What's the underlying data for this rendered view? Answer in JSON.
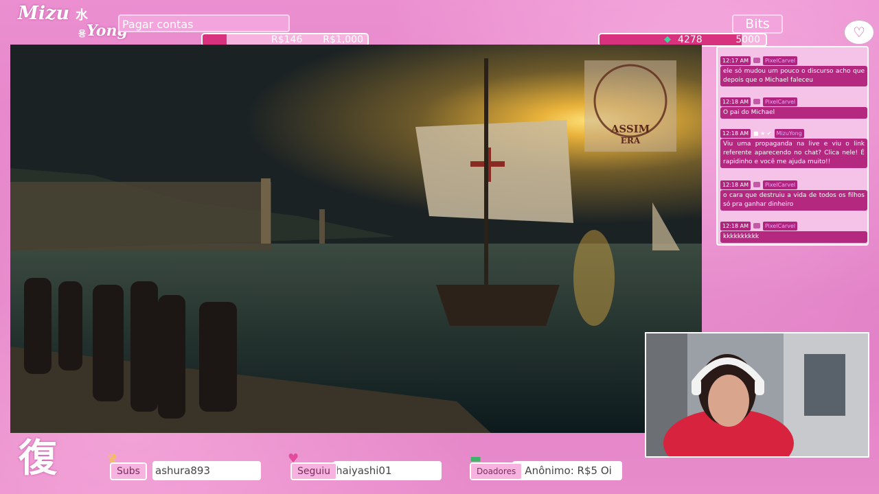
{
  "logo": {
    "line1": "Mizu",
    "kanji": "水",
    "korean": "용",
    "line2": "Yong"
  },
  "goal": {
    "title": "Pagar contas",
    "current": "R$146",
    "target": "R$1,000",
    "progress": 0.146
  },
  "bits": {
    "title": "Bits",
    "current": "4278",
    "target": "5000",
    "progress": 0.8556,
    "gem_icon": "bits-gem-icon"
  },
  "heart_icon": "heart-chat-icon",
  "chat": {
    "messages": [
      {
        "time": "12:17 AM",
        "user": "PixelCarvel",
        "text": "ele só mudou um pouco o discurso acho que depois que o Michael faleceu"
      },
      {
        "time": "12:18 AM",
        "user": "PixelCarvel",
        "text": "O pai do Michael"
      },
      {
        "time": "12:18 AM",
        "user": "MizuYong",
        "text": "Viu uma propaganda na live e viu o link referente aparecendo no chat? Clica nele! É rapidinho e você me ajuda muito!!"
      },
      {
        "time": "12:18 AM",
        "user": "PixelCarvel",
        "text": "o cara que destruiu a vida de todos os filhos só pra ganhar dinheiro"
      },
      {
        "time": "12:18 AM",
        "user": "PixelCarvel",
        "text": "kkkkkkkkkk"
      }
    ]
  },
  "video": {
    "watermark_line1": "ASSIM",
    "watermark_line2": "ERA"
  },
  "corner_kanji": "復",
  "events": {
    "subs": {
      "label": "Subs",
      "value": "ashura893"
    },
    "follow": {
      "label": "Seguiu",
      "value": "haiyashi01"
    },
    "donors": {
      "label": "Doadores",
      "value": "5   Anônimo: R$5   Oi"
    }
  },
  "colors": {
    "accent": "#d8317e",
    "chat_bubble": "#b5287f",
    "background": "#e685c8"
  }
}
